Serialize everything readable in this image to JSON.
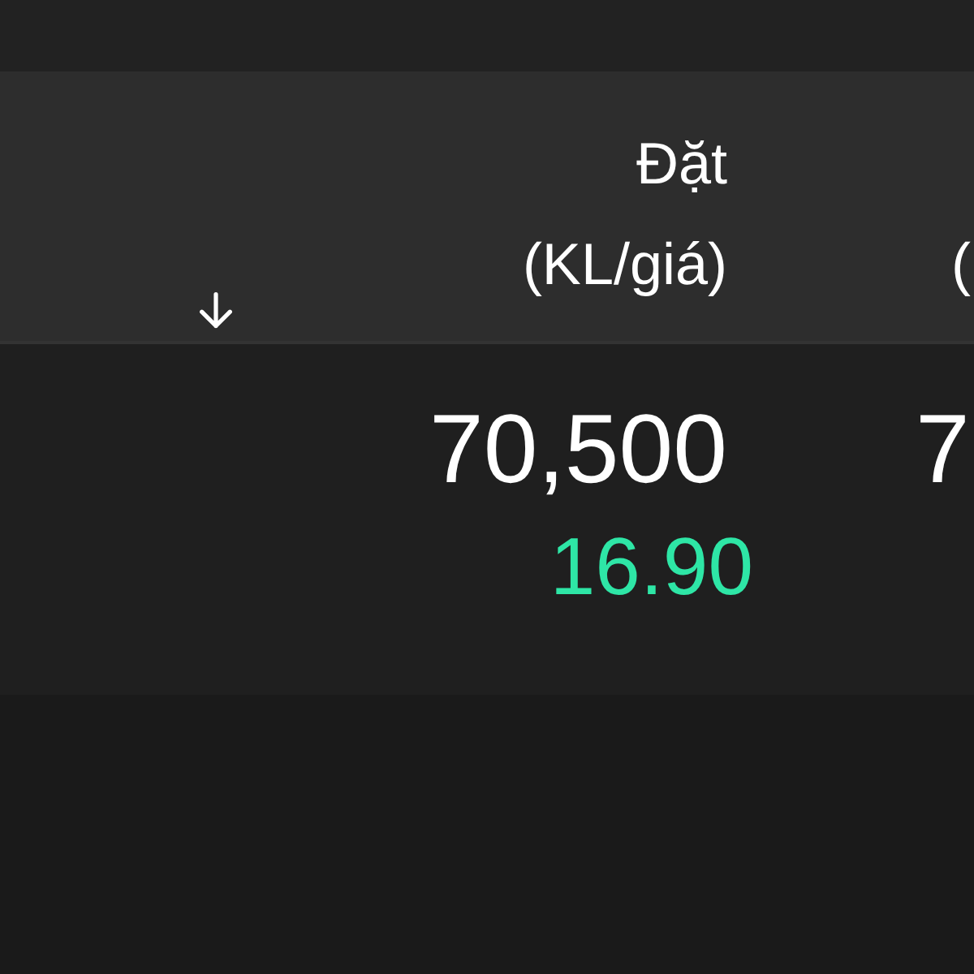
{
  "table": {
    "columns": [
      {
        "sort_descending": true
      },
      {
        "label_lines": [
          "Đặt",
          "(KL/giá)"
        ]
      },
      {
        "label_lines": [
          "("
        ]
      }
    ],
    "rows": [
      {
        "cells": [
          {},
          {
            "value": "70,500",
            "change": "16.90",
            "rising": true
          },
          {
            "value": "7"
          }
        ]
      }
    ]
  }
}
